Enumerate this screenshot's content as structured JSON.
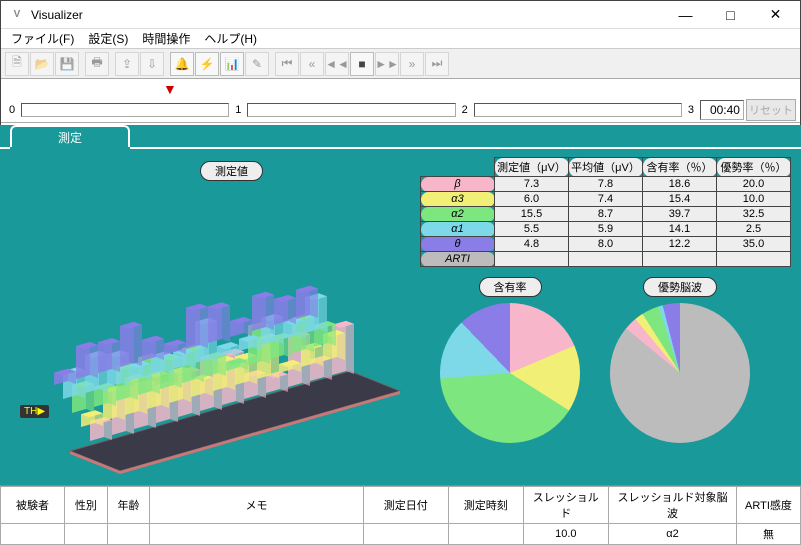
{
  "window": {
    "title": "Visualizer",
    "app_icon": "V"
  },
  "menu": {
    "file": "ファイル(F)",
    "settings": "設定(S)",
    "time_ops": "時間操作",
    "help": "ヘルプ(H)"
  },
  "slider": {
    "labels": [
      "0",
      "1",
      "2",
      "3"
    ],
    "time": "00:40",
    "reset": "リセット"
  },
  "tab": {
    "label": "測定"
  },
  "labels": {
    "measurement_value": "測定値",
    "content_rate": "含有率",
    "dominant_wave": "優勢脳波",
    "th_badge": "TH"
  },
  "table": {
    "headers": [
      "測定値（μV）",
      "平均値（μV）",
      "含有率（％）",
      "優勢率（％）"
    ],
    "rows": [
      {
        "band": "β",
        "color": "#f7b6c9",
        "vals": [
          "7.3",
          "7.8",
          "18.6",
          "20.0"
        ]
      },
      {
        "band": "α3",
        "color": "#f2ef77",
        "vals": [
          "6.0",
          "7.4",
          "15.4",
          "10.0"
        ]
      },
      {
        "band": "α2",
        "color": "#7ee67e",
        "vals": [
          "15.5",
          "8.7",
          "39.7",
          "32.5"
        ]
      },
      {
        "band": "α1",
        "color": "#7dd8e8",
        "vals": [
          "5.5",
          "5.9",
          "14.1",
          "2.5"
        ]
      },
      {
        "band": "θ",
        "color": "#8a7de8",
        "vals": [
          "4.8",
          "8.0",
          "12.2",
          "35.0"
        ]
      },
      {
        "band": "ARTI",
        "color": "#bcbcbc",
        "vals": [
          "",
          "",
          "",
          ""
        ]
      }
    ]
  },
  "chart_data": [
    {
      "type": "pie",
      "title": "含有率",
      "series": [
        {
          "name": "β",
          "value": 18.6,
          "color": "#f7b6c9"
        },
        {
          "name": "α3",
          "value": 15.4,
          "color": "#f2ef77"
        },
        {
          "name": "α2",
          "value": 39.7,
          "color": "#7ee67e"
        },
        {
          "name": "α1",
          "value": 14.1,
          "color": "#7dd8e8"
        },
        {
          "name": "θ",
          "value": 12.2,
          "color": "#8a7de8"
        }
      ]
    },
    {
      "type": "pie",
      "title": "優勢脳波",
      "series": [
        {
          "name": "ARTI/他",
          "value": 86,
          "color": "#bcbcbc"
        },
        {
          "name": "β",
          "value": 3,
          "color": "#f7b6c9"
        },
        {
          "name": "α3",
          "value": 2,
          "color": "#f2ef77"
        },
        {
          "name": "α2",
          "value": 4,
          "color": "#7ee67e"
        },
        {
          "name": "α1",
          "value": 1,
          "color": "#7dd8e8"
        },
        {
          "name": "θ",
          "value": 4,
          "color": "#8a7de8"
        }
      ]
    },
    {
      "type": "bar",
      "title": "測定値 3D 棒グラフ（チャンネル×帯域）",
      "note": "Isometric per-channel EEG band bar chart; values not numerically labeled in source",
      "bands": [
        "β",
        "α3",
        "α2",
        "α1",
        "θ"
      ],
      "colors": [
        "#f7b6c9",
        "#f2ef77",
        "#7ee67e",
        "#7dd8e8",
        "#8a7de8"
      ]
    }
  ],
  "info": {
    "headers": [
      "被験者",
      "性別",
      "年齢",
      "メモ",
      "測定日付",
      "測定時刻",
      "スレッショルド",
      "スレッショルド対象脳波",
      "ARTI感度"
    ],
    "values": [
      "",
      "",
      "",
      "",
      "",
      "",
      "10.0",
      "α2",
      "無"
    ]
  }
}
